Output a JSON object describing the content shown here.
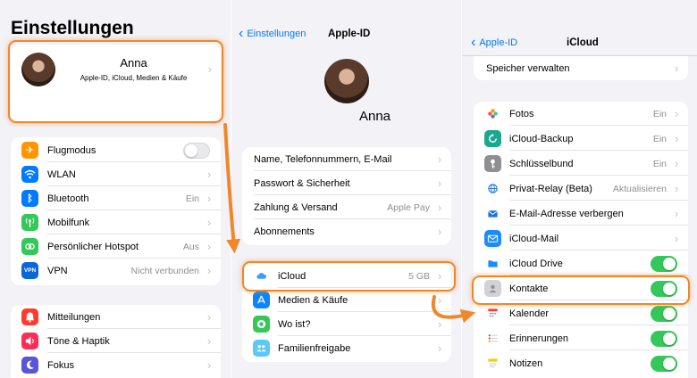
{
  "panel1": {
    "title": "Einstellungen",
    "profile": {
      "name": "Anna",
      "subtitle": "Apple-ID, iCloud, Medien & Käufe"
    },
    "group1": [
      {
        "label": "Flugmodus",
        "value": "",
        "toggle": "off",
        "icon": "airplane-icon",
        "color": "#ff9500",
        "glyph": "✈"
      },
      {
        "label": "WLAN",
        "value": "",
        "icon": "wifi-icon",
        "color": "#007aff",
        "glyph": ""
      },
      {
        "label": "Bluetooth",
        "value": "Ein",
        "icon": "bluetooth-icon",
        "color": "#007aff",
        "glyph": "ᛒ"
      },
      {
        "label": "Mobilfunk",
        "value": "",
        "icon": "antenna-icon",
        "color": "#34c759",
        "glyph": ""
      },
      {
        "label": "Persönlicher Hotspot",
        "value": "Aus",
        "icon": "hotspot-icon",
        "color": "#34c759",
        "glyph": ""
      },
      {
        "label": "VPN",
        "value": "Nicht verbunden",
        "icon": "vpn-icon",
        "color": "#0a66d9",
        "glyph": "VPN"
      }
    ],
    "group2": [
      {
        "label": "Mitteilungen",
        "icon": "bell-icon",
        "color": "#ff3b30",
        "glyph": ""
      },
      {
        "label": "Töne & Haptik",
        "icon": "speaker-icon",
        "color": "#ff2d55",
        "glyph": ""
      },
      {
        "label": "Fokus",
        "icon": "moon-icon",
        "color": "#5856d6",
        "glyph": ""
      }
    ]
  },
  "panel2": {
    "back": "Einstellungen",
    "title": "Apple-ID",
    "name": "Anna",
    "group1": [
      {
        "label": "Name, Telefonnummern, E-Mail"
      },
      {
        "label": "Passwort & Sicherheit"
      },
      {
        "label": "Zahlung & Versand",
        "value": "Apple Pay"
      },
      {
        "label": "Abonnements"
      }
    ],
    "group2": [
      {
        "label": "iCloud",
        "value": "5 GB",
        "icon": "cloud-icon",
        "color": "#ffffff"
      },
      {
        "label": "Medien & Käufe",
        "icon": "app-store-icon",
        "color": "#0a84ff"
      },
      {
        "label": "Wo ist?",
        "icon": "find-my-icon",
        "color": "#34c759"
      },
      {
        "label": "Familienfreigabe",
        "icon": "family-icon",
        "color": "#5ac8fa"
      }
    ]
  },
  "panel3": {
    "back": "Apple-ID",
    "title": "iCloud",
    "storage": "Speicher verwalten",
    "apps": [
      {
        "label": "Fotos",
        "value": "Ein",
        "icon": "photos-icon",
        "color": "#ffffff"
      },
      {
        "label": "iCloud-Backup",
        "value": "Ein",
        "icon": "backup-icon",
        "color": "#1aa88e"
      },
      {
        "label": "Schlüsselbund",
        "value": "Ein",
        "icon": "key-icon",
        "color": "#8e8e93"
      },
      {
        "label": "Privat-Relay (Beta)",
        "value": "Aktualisieren",
        "icon": "globe-icon",
        "color": "#ffffff"
      },
      {
        "label": "E-Mail-Adresse verbergen",
        "value": "",
        "icon": "hide-mail-icon",
        "color": "#ffffff"
      },
      {
        "label": "iCloud-Mail",
        "value": "",
        "icon": "mail-icon",
        "color": "#1a8cff"
      },
      {
        "label": "iCloud Drive",
        "toggle": "on",
        "icon": "folder-icon",
        "color": "#ffffff"
      },
      {
        "label": "Kontakte",
        "toggle": "on",
        "icon": "contacts-icon",
        "color": "#d1d1d6"
      },
      {
        "label": "Kalender",
        "toggle": "on",
        "icon": "calendar-icon",
        "color": "#ffffff"
      },
      {
        "label": "Erinnerungen",
        "toggle": "on",
        "icon": "reminders-icon",
        "color": "#ffffff"
      },
      {
        "label": "Notizen",
        "toggle": "on",
        "icon": "notes-icon",
        "color": "#ffffff"
      }
    ]
  },
  "colors": {
    "accent": "#007aff",
    "highlight": "#f0882a",
    "toggle_on": "#34c759"
  }
}
